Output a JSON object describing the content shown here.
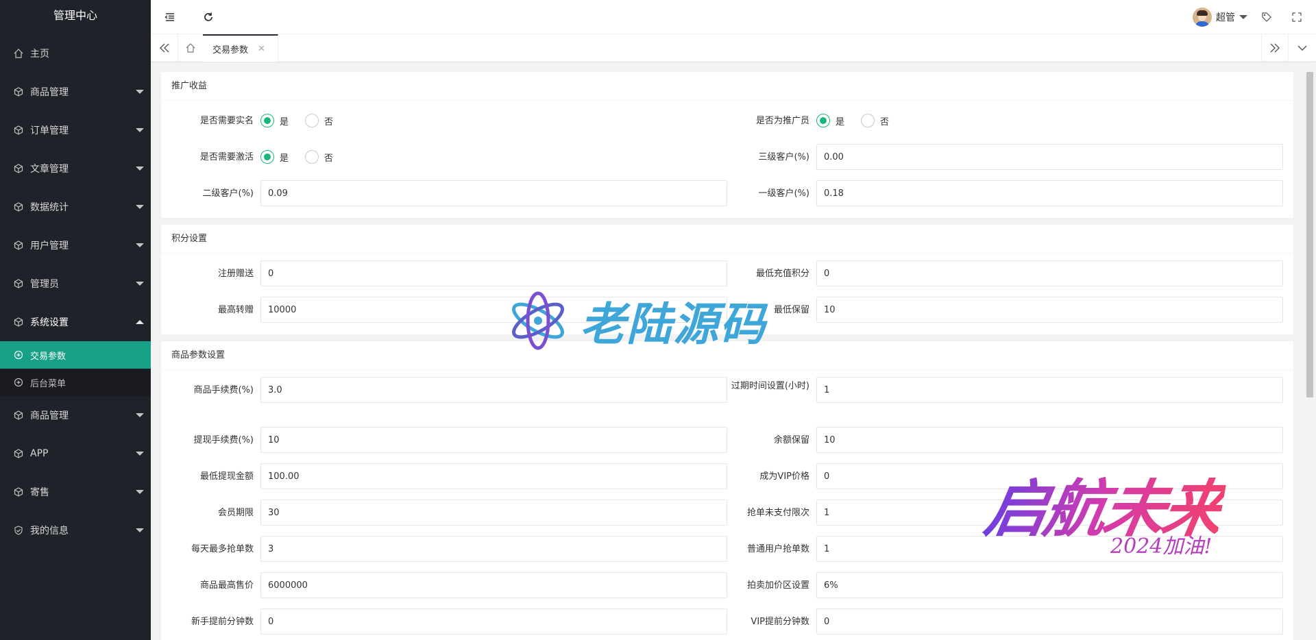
{
  "sidebar": {
    "title": "管理中心",
    "items": [
      {
        "label": "主页",
        "icon": "home-icon"
      },
      {
        "label": "商品管理",
        "icon": "cube-icon"
      },
      {
        "label": "订单管理",
        "icon": "cube-icon"
      },
      {
        "label": "文章管理",
        "icon": "cube-icon"
      },
      {
        "label": "数据统计",
        "icon": "cube-icon"
      },
      {
        "label": "用户管理",
        "icon": "cube-icon"
      },
      {
        "label": "管理员",
        "icon": "cube-icon"
      },
      {
        "label": "系统设置",
        "icon": "cube-icon"
      }
    ],
    "sub_items": [
      {
        "label": "交易参数",
        "icon": "circle-plus-icon"
      },
      {
        "label": "后台菜单",
        "icon": "circle-plus-icon"
      }
    ],
    "items_after": [
      {
        "label": "商品管理",
        "icon": "cube-icon"
      },
      {
        "label": "APP",
        "icon": "cube-icon"
      },
      {
        "label": "寄售",
        "icon": "cube-icon"
      },
      {
        "label": "我的信息",
        "icon": "shield-icon"
      }
    ]
  },
  "header": {
    "username": "超管"
  },
  "tabs": {
    "active": "交易参数"
  },
  "sections": {
    "promo": {
      "title": "推广收益",
      "need_realname_label": "是否需要实名",
      "is_promoter_label": "是否为推广员",
      "need_activate_label": "是否需要激活",
      "yes": "是",
      "no": "否",
      "level3_label": "三级客户(%)",
      "level3_value": "0.00",
      "level2_label": "二级客户(%)",
      "level2_value": "0.09",
      "level1_label": "一级客户(%)",
      "level1_value": "0.18"
    },
    "points": {
      "title": "积分设置",
      "register_label": "注册赠送",
      "register_value": "0",
      "min_recharge_label": "最低充值积分",
      "min_recharge_value": "0",
      "max_transfer_label": "最高转赠",
      "max_transfer_value": "10000",
      "min_reserve_label": "最低保留",
      "min_reserve_value": "10"
    },
    "goods": {
      "title": "商品参数设置",
      "fields": [
        {
          "label": "商品手续费(%)",
          "value": "3.0"
        },
        {
          "label": "过期时间设置(小时)",
          "value": "1"
        },
        {
          "label": "提现手续费(%)",
          "value": "10"
        },
        {
          "label": "余额保留",
          "value": "10"
        },
        {
          "label": "最低提现金额",
          "value": "100.00"
        },
        {
          "label": "成为VIP价格",
          "value": "0"
        },
        {
          "label": "会员期限",
          "value": "30"
        },
        {
          "label": "抢单未支付限次",
          "value": "1"
        },
        {
          "label": "每天最多抢单数",
          "value": "3"
        },
        {
          "label": "普通用户抢单数",
          "value": "1"
        },
        {
          "label": "商品最高售价",
          "value": "6000000"
        },
        {
          "label": "拍卖加价区设置",
          "value": "6%"
        },
        {
          "label": "新手提前分钟数",
          "value": "0"
        },
        {
          "label": "VIP提前分钟数",
          "value": "0"
        }
      ]
    }
  },
  "watermarks": {
    "brand": "老陆源码",
    "slogan": "启航未来",
    "sub": "2024加油!"
  },
  "colors": {
    "accent": "#16a086",
    "sidebar_bg": "#20222a",
    "radio_checked": "#16b777"
  }
}
